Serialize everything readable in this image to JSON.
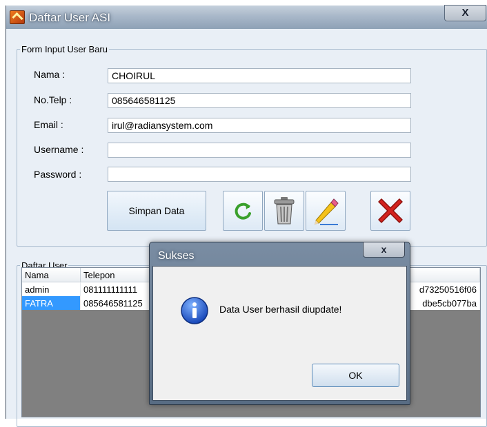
{
  "window": {
    "title": "Daftar User ASI",
    "close_label": "X"
  },
  "form": {
    "group_title": "Form Input User Baru",
    "fields": [
      {
        "label": "Nama :",
        "value": "CHOIRUL"
      },
      {
        "label": "No.Telp :",
        "value": "085646581125"
      },
      {
        "label": "Email :",
        "value": "irul@radiansystem.com"
      },
      {
        "label": "Username :",
        "value": ""
      },
      {
        "label": "Password :",
        "value": ""
      }
    ],
    "save_button": "Simpan Data",
    "action_icons": [
      "refresh-icon",
      "trash-icon",
      "pencil-icon",
      "delete-icon"
    ]
  },
  "user_list": {
    "group_title": "Daftar User",
    "columns": [
      "Nama",
      "Telepon",
      "",
      "",
      ""
    ],
    "rows": [
      {
        "nama": "admin",
        "telepon": "081111111111",
        "hash": "d73250516f06",
        "selected": false
      },
      {
        "nama": "FATRA",
        "telepon": "085646581125",
        "hash": "dbe5cb077ba",
        "selected": true
      }
    ]
  },
  "dialog": {
    "title": "Sukses",
    "close_label": "x",
    "message": "Data User berhasil diupdate!",
    "ok_label": "OK",
    "icon": "info-icon"
  },
  "colors": {
    "selection": "#3399ff",
    "delete_red": "#d3221d",
    "refresh_green": "#3aa02c"
  }
}
